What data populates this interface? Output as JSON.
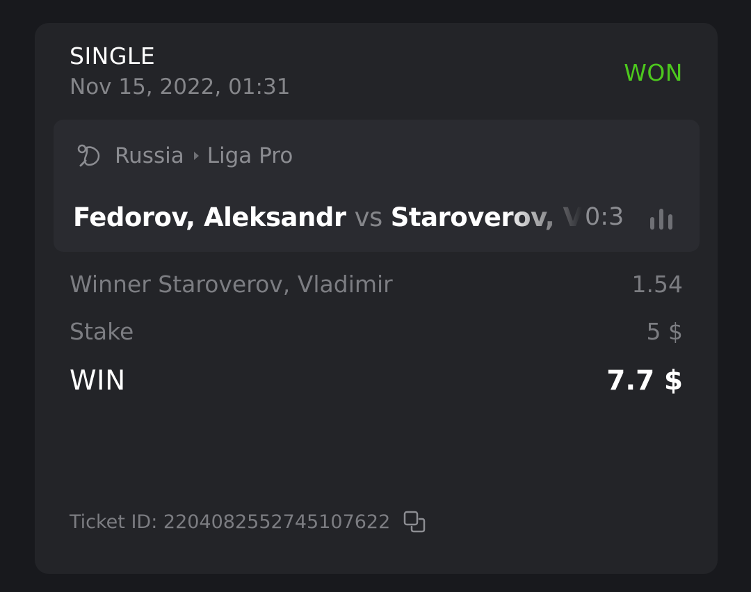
{
  "bet": {
    "type": "SINGLE",
    "date": "Nov 15, 2022, 01:31",
    "status": "WON",
    "status_color": "#4dc81e"
  },
  "event": {
    "sport_icon": "table-tennis-icon",
    "country": "Russia",
    "league": "Liga Pro",
    "player1": "Fedorov, Aleksandr",
    "vs": "vs",
    "player2": "Staroverov, Vladimir",
    "score": "0:3",
    "stats_icon": "stats-bars-icon"
  },
  "details": {
    "selection_label": "Winner Staroverov, Vladimir",
    "odds": "1.54",
    "stake_label": "Stake",
    "stake_value": "5 $",
    "win_label": "WIN",
    "win_value": "7.7 $"
  },
  "ticket": {
    "label": "Ticket ID: 2204082552745107622",
    "copy_icon": "copy-icon"
  }
}
